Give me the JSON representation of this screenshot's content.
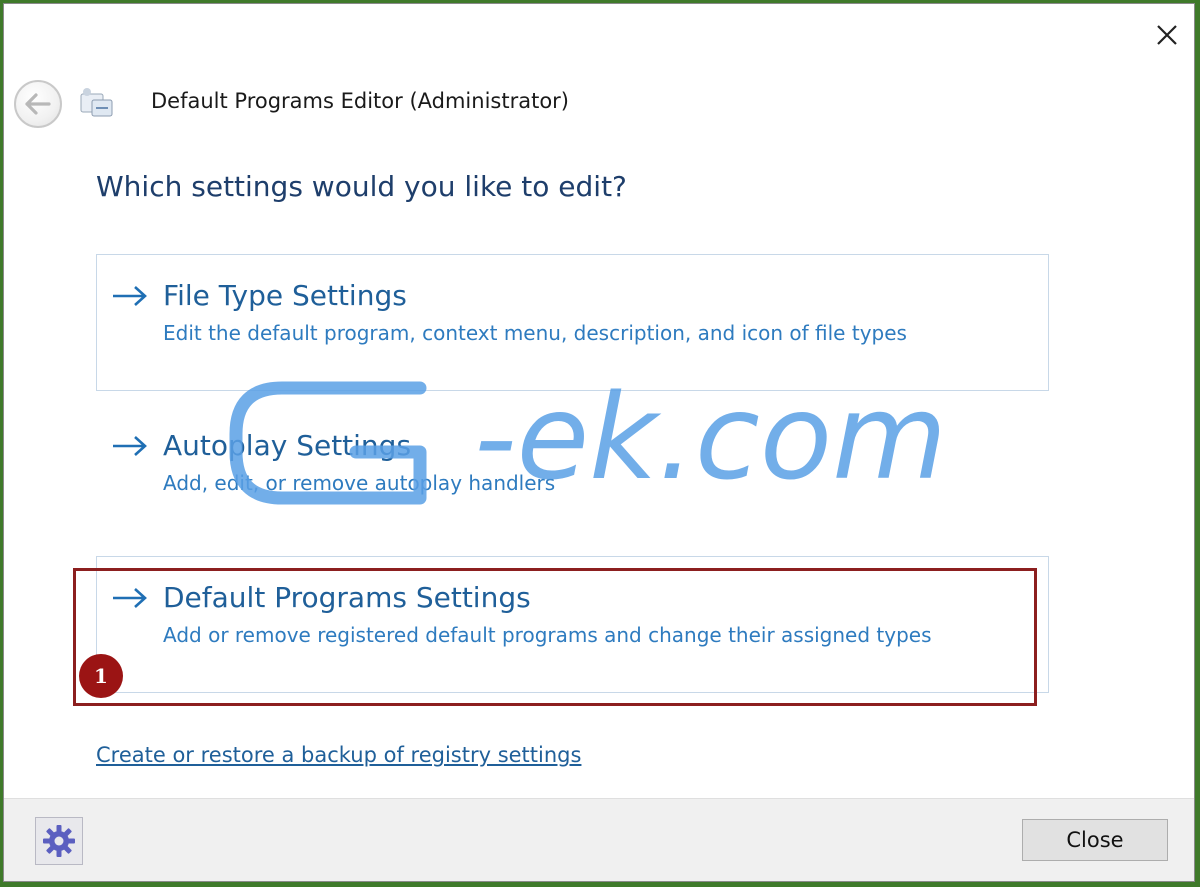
{
  "window": {
    "title": "Default Programs Editor (Administrator)"
  },
  "main": {
    "heading": "Which settings would you like to edit?",
    "options": [
      {
        "title": "File Type Settings",
        "description": "Edit the default program, context menu, description, and icon of file types"
      },
      {
        "title": "Autoplay Settings",
        "description": "Add, edit, or remove autoplay handlers"
      },
      {
        "title": "Default Programs Settings",
        "description": "Add or remove registered default programs and change their assigned types"
      }
    ],
    "backup_link": "Create or restore a backup of registry settings"
  },
  "annotation": {
    "badge": "1",
    "color": "#8c1f1f"
  },
  "watermark": {
    "text": "G-ek.com",
    "color": "#5aa0e6"
  },
  "footer": {
    "close_label": "Close",
    "settings_icon": "gear-icon"
  },
  "colors": {
    "link_blue": "#1f5f99",
    "heading_navy": "#1e3e6b",
    "option_border": "#c8d8e8"
  }
}
